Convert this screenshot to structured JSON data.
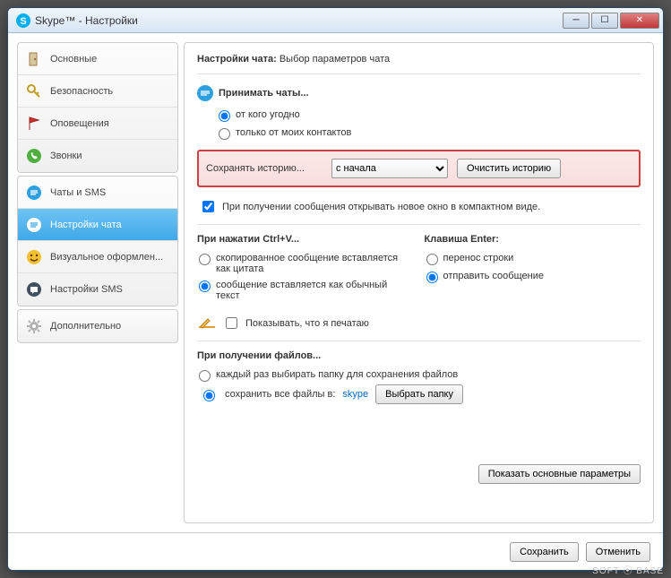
{
  "window": {
    "title": "Skype™ - Настройки"
  },
  "sidebar": {
    "groups": [
      {
        "items": [
          {
            "id": "main",
            "label": "Основные",
            "icon": "door"
          },
          {
            "id": "security",
            "label": "Безопасность",
            "icon": "key"
          },
          {
            "id": "notify",
            "label": "Оповещения",
            "icon": "flag"
          },
          {
            "id": "calls",
            "label": "Звонки",
            "icon": "phone"
          }
        ]
      },
      {
        "items": [
          {
            "id": "chats",
            "label": "Чаты и SMS",
            "icon": "chat-blue"
          },
          {
            "id": "chat-settings",
            "label": "Настройки чата",
            "icon": "chat-accent",
            "selected": true
          },
          {
            "id": "visual",
            "label": "Визуальное оформлен...",
            "icon": "smiley"
          },
          {
            "id": "sms-settings",
            "label": "Настройки SMS",
            "icon": "sms"
          }
        ]
      },
      {
        "items": [
          {
            "id": "advanced",
            "label": "Дополнительно",
            "icon": "gear"
          }
        ]
      }
    ]
  },
  "content": {
    "header_bold": "Настройки чата:",
    "header_rest": "Выбор параметров чата",
    "accept": {
      "title": "Принимать чаты...",
      "opt_anyone": "от кого угодно",
      "opt_contacts": "только от моих контактов"
    },
    "history": {
      "label": "Сохранять историю...",
      "selected": "с начала",
      "clear_btn": "Очистить историю"
    },
    "open_compact": "При получении сообщения открывать новое окно в компактном виде.",
    "ctrlv": {
      "title": "При нажатии Ctrl+V...",
      "opt_quote": "скопированное сообщение вставляется как цитата",
      "opt_plain": "сообщение вставляется как обычный текст"
    },
    "enter": {
      "title": "Клавиша Enter:",
      "opt_newline": "перенос строки",
      "opt_send": "отправить сообщение"
    },
    "typing_label": "Показывать, что я печатаю",
    "files": {
      "title": "При получении файлов...",
      "opt_ask": "каждый раз выбирать папку для сохранения файлов",
      "opt_saveall": "сохранить все файлы в:",
      "folder": "skype",
      "choose_btn": "Выбрать папку"
    },
    "show_main_btn": "Показать основные параметры"
  },
  "footer": {
    "save": "Сохранить",
    "cancel": "Отменить"
  },
  "watermark": "SOFT ⦿ BASE"
}
